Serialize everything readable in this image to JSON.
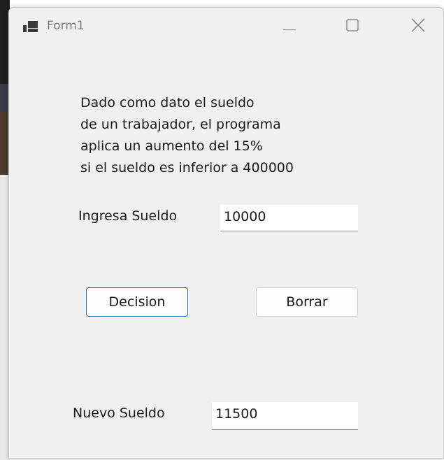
{
  "window": {
    "title": "Form1"
  },
  "titlebar": {
    "app_icon": "winforms-app-icon",
    "minimize_icon": "minimize-icon",
    "maximize_icon": "maximize-icon",
    "close_icon": "close-icon"
  },
  "form": {
    "description": "Dado como dato el sueldo\nde un trabajador, el programa\naplica un aumento del 15%\nsi el sueldo es inferior a 400000",
    "sueldo_label": "Ingresa Sueldo",
    "sueldo_value": "10000",
    "decision_button": "Decision",
    "borrar_button": "Borrar",
    "nuevo_label": "Nuevo Sueldo",
    "nuevo_value": "11500"
  },
  "colors": {
    "window_bg": "#f0f0f0",
    "focus_border": "#2a6fb8"
  }
}
